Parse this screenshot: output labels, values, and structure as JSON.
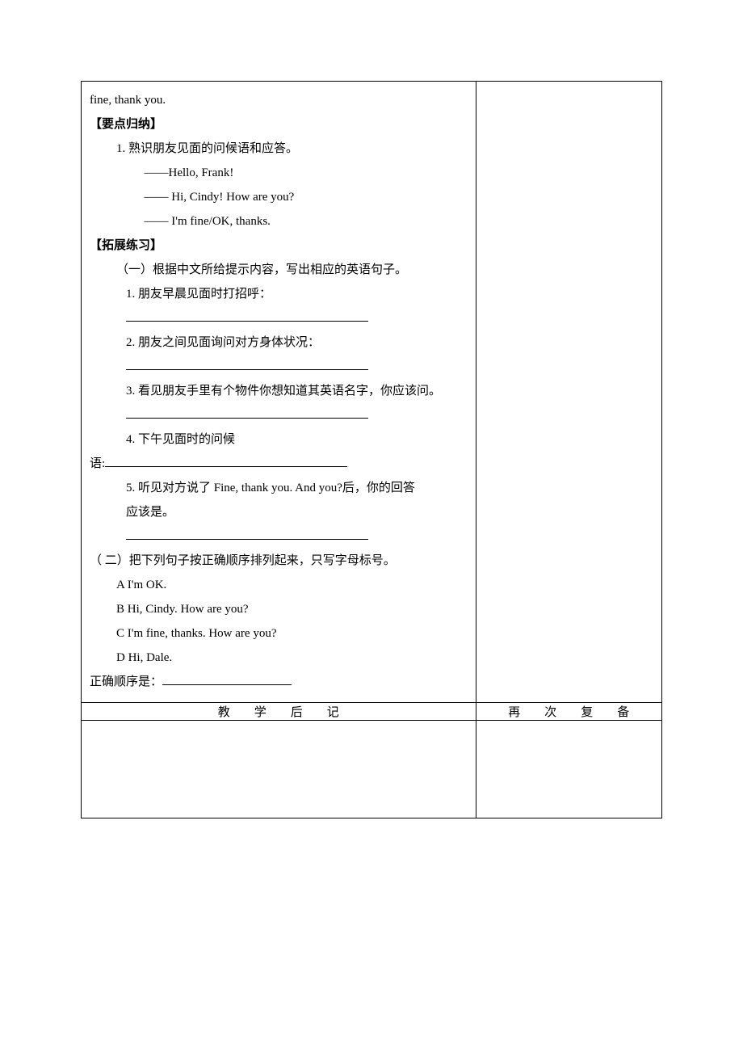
{
  "top": {
    "line0": "fine, thank you.",
    "section1_title": "【要点归纳】",
    "s1_item1": "1. 熟识朋友见面的问候语和应答。",
    "s1_dlg1": "——Hello, Frank!",
    "s1_dlg2": "—— Hi, Cindy! How are you?",
    "s1_dlg3": "——  I'm fine/OK, thanks.",
    "section2_title": "【拓展练习】",
    "s2_part1_intro": "（一）根据中文所给提示内容，写出相应的英语句子。",
    "s2_q1": "1. 朋友早晨见面时打招呼：",
    "s2_q2": "2. 朋友之间见面询问对方身体状况：",
    "s2_q3": "3. 看见朋友手里有个物件你想知道其英语名字，你应该问。",
    "s2_q4_pre": "4. 下午见面时的问候",
    "s2_q4_label": "语:",
    "s2_q5a": "5. 听见对方说了 Fine, thank you. And you?后，你的回答",
    "s2_q5b": "应该是。",
    "s2_part2_intro": "（ 二）把下列句子按正确顺序排列起来，只写字母标号。",
    "s2_optA": "A   I'm OK.",
    "s2_optB": "B    Hi, Cindy. How are you?",
    "s2_optC": "C    I'm fine, thanks. How are you?",
    "s2_optD": "D    Hi, Dale.",
    "s2_order_label": "正确顺序是："
  },
  "footer": {
    "left_header": "教学后记",
    "right_header": "再次复备"
  }
}
